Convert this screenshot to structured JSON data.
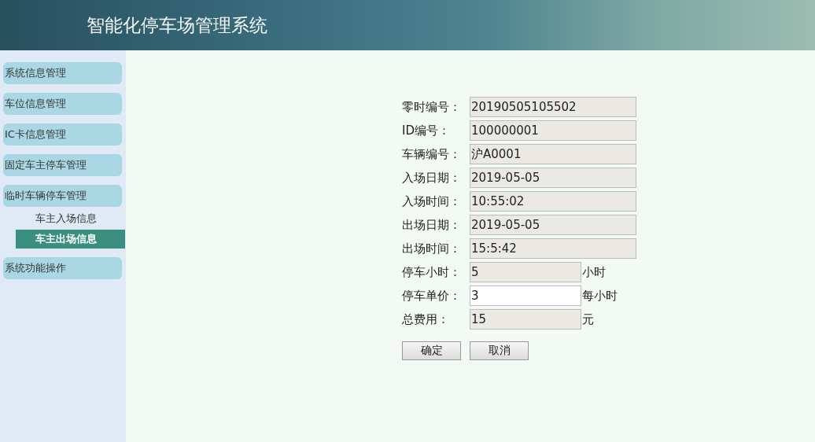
{
  "header": {
    "title": "智能化停车场管理系统"
  },
  "sidebar": {
    "items": [
      {
        "label": "系统信息管理"
      },
      {
        "label": "车位信息管理"
      },
      {
        "label": "IC卡信息管理"
      },
      {
        "label": "固定车主停车管理"
      },
      {
        "label": "临时车辆停车管理",
        "children": [
          {
            "label": "车主入场信息",
            "selected": false
          },
          {
            "label": "车主出场信息",
            "selected": true
          }
        ]
      },
      {
        "label": "系统功能操作"
      }
    ]
  },
  "form": {
    "fields": [
      {
        "label": "零时编号：",
        "value": "20190505105502",
        "readonly": true
      },
      {
        "label": "ID编号：",
        "value": "100000001",
        "readonly": true
      },
      {
        "label": "车辆编号：",
        "value": "沪A0001",
        "readonly": true
      },
      {
        "label": "入场日期：",
        "value": "2019-05-05",
        "readonly": true
      },
      {
        "label": "入场时间：",
        "value": "10:55:02",
        "readonly": true
      },
      {
        "label": "出场日期：",
        "value": "2019-05-05",
        "readonly": true
      },
      {
        "label": "出场时间：",
        "value": "15:5:42",
        "readonly": true
      },
      {
        "label": "停车小时：",
        "value": "5",
        "readonly": true,
        "unit": "小时"
      },
      {
        "label": "停车单价：",
        "value": "3",
        "readonly": false,
        "unit": "每小时"
      },
      {
        "label": "总费用：",
        "value": "15",
        "readonly": true,
        "unit": "元"
      }
    ],
    "buttons": [
      "确定",
      "取消"
    ]
  }
}
